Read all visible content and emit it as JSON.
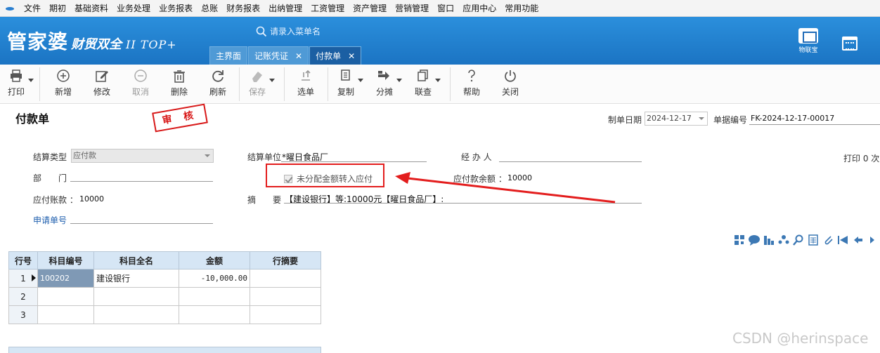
{
  "menu": [
    "文件",
    "期初",
    "基础资料",
    "业务处理",
    "业务报表",
    "总账",
    "财务报表",
    "出纳管理",
    "工资管理",
    "资产管理",
    "营销管理",
    "窗口",
    "应用中心",
    "常用功能"
  ],
  "brand": {
    "name": "管家婆",
    "sub": "财贸双全",
    "edition": "II TOP+"
  },
  "header": {
    "search_placeholder": "请录入菜单名",
    "tabs": [
      {
        "label": "主界面"
      },
      {
        "label": "记账凭证",
        "close": "✕"
      },
      {
        "label": "付款单",
        "close": "✕"
      }
    ],
    "iot_label": "物联宝"
  },
  "toolbar": {
    "print": "打印",
    "new": "新增",
    "edit": "修改",
    "cancel": "取消",
    "delete": "删除",
    "refresh": "刷新",
    "save": "保存",
    "select": "选单",
    "copy": "复制",
    "split": "分摊",
    "link": "联查",
    "help": "帮助",
    "close": "关闭"
  },
  "form": {
    "title": "付款单",
    "stamp": "审 核",
    "date_label": "制单日期",
    "date_value": "2024-12-17",
    "number_label": "单据编号",
    "number_value": "FK-2024-12-17-00017",
    "print_count": "打印 0 次",
    "settle_type_label": "结算类型",
    "settle_type_value": "应付款",
    "settle_unit_label": "结算单位",
    "settle_unit_value": "*曜日食品厂",
    "handler_label": "经 办 人",
    "dept_label": "部　　门",
    "checkbox_label": "未分配金额转入应付",
    "payable_balance_label": "应付款余额 ：",
    "payable_balance_value": "10000",
    "payable_account_label": "应付账款 ：",
    "payable_account_value": "10000",
    "summary_label": "摘　　要",
    "summary_value": "【建设银行】等:10000元【曜日食品厂】:",
    "apply_no_label": "申请单号"
  },
  "grid": {
    "columns": [
      "行号",
      "科目编号",
      "科目全名",
      "金额",
      "行摘要"
    ],
    "rows": [
      {
        "no": "1",
        "code": "100202",
        "name": "建设银行",
        "amount": "-10,000.00",
        "memo": ""
      },
      {
        "no": "2",
        "code": "",
        "name": "",
        "amount": "",
        "memo": ""
      },
      {
        "no": "3",
        "code": "",
        "name": "",
        "amount": "",
        "memo": ""
      }
    ]
  },
  "watermark": "CSDN @herinspace",
  "colors": {
    "header": "#1b74c3",
    "stamp": "#d81818",
    "highlight": "#e31d1d",
    "grid_header": "#d6e6f5"
  }
}
